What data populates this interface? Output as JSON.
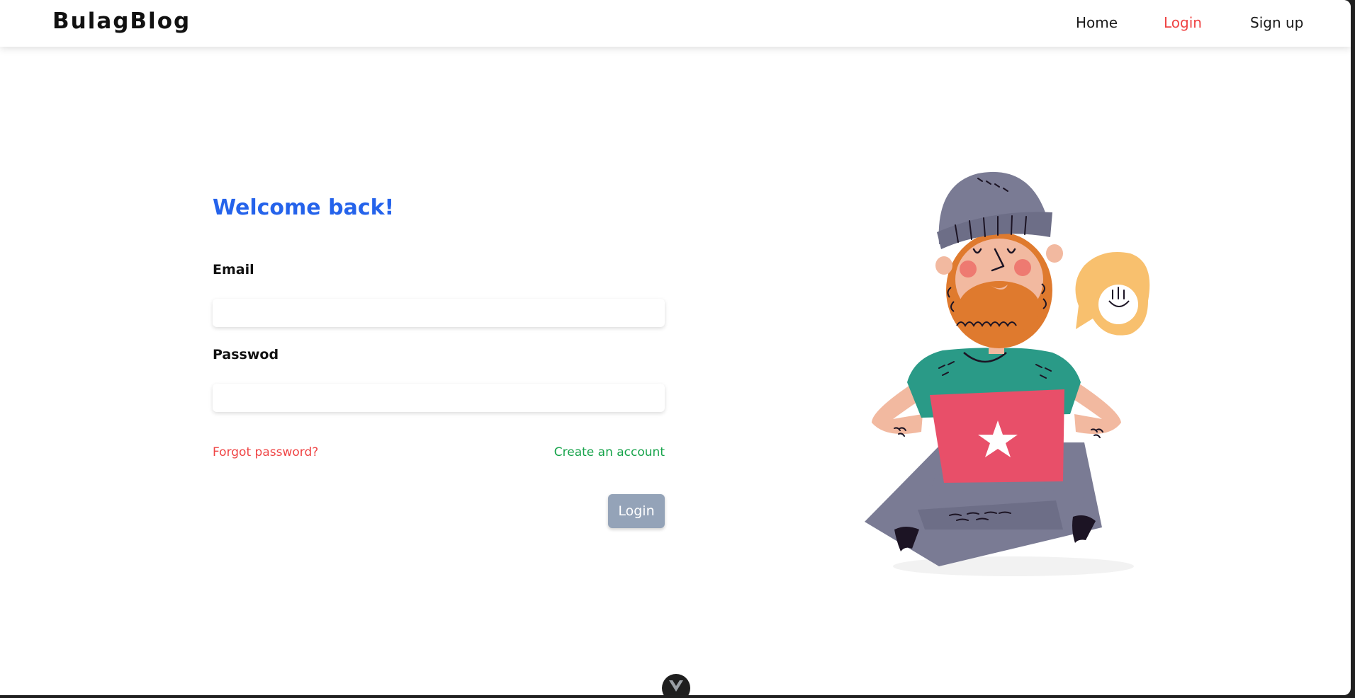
{
  "navbar": {
    "brand": "BulagBlog",
    "links": [
      {
        "label": "Home"
      },
      {
        "label": "Login",
        "active": true
      },
      {
        "label": "Sign up"
      }
    ]
  },
  "login_form": {
    "title": "Welcome back!",
    "email_label": "Email",
    "email_value": "",
    "password_label": "Passwod",
    "password_value": "",
    "forgot_password": "Forgot password?",
    "create_account": "Create an account",
    "submit_label": "Login"
  },
  "illustration": {
    "subject": "bearded man with beanie and laptop, speech bubble with waving hand"
  },
  "colors": {
    "accent_blue": "#2563eb",
    "link_red": "#ef4444",
    "link_green": "#16a34a",
    "button_gray": "#94a3b8"
  },
  "icons": {
    "devtools_toggle": "vue-logo-icon"
  }
}
